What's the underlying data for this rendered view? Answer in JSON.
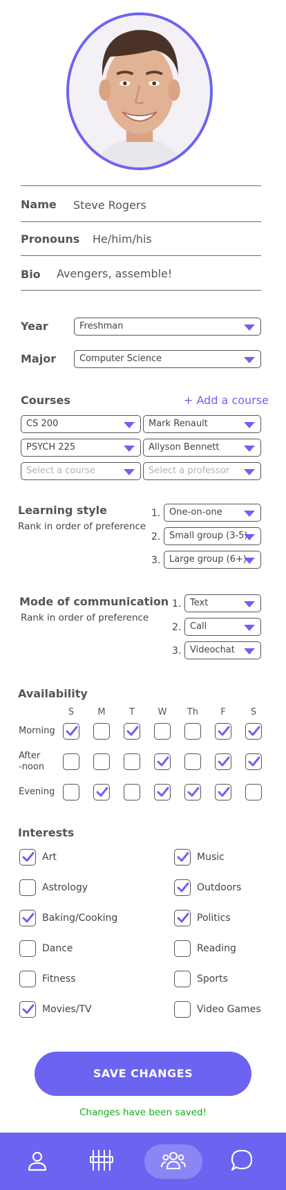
{
  "profile": {
    "name_label": "Name",
    "name_value": "Steve Rogers",
    "pronouns_label": "Pronouns",
    "pronouns_value": "He/him/his",
    "bio_label": "Bio",
    "bio_value": "Avengers, assemble!"
  },
  "academics": {
    "year_label": "Year",
    "year_value": "Freshman",
    "major_label": "Major",
    "major_value": "Computer Science"
  },
  "courses": {
    "title": "Courses",
    "add_label": "+ Add a course",
    "rows": [
      {
        "course": "CS 200",
        "professor": "Mark Renault"
      },
      {
        "course": "PSYCH 225",
        "professor": "Allyson Bennett"
      }
    ],
    "course_placeholder": "Select a course",
    "professor_placeholder": "Select a professor"
  },
  "learning_style": {
    "title": "Learning style",
    "subtitle": "Rank in order of preference",
    "ranks": [
      "1.",
      "2.",
      "3."
    ],
    "options": [
      "One-on-one",
      "Small group (3-5)",
      "Large group (6+)"
    ]
  },
  "communication": {
    "title": "Mode of communication",
    "subtitle": "Rank in order of preference",
    "ranks": [
      "1.",
      "2.",
      "3."
    ],
    "options": [
      "Text",
      "Call",
      "Videochat"
    ]
  },
  "availability": {
    "title": "Availability",
    "days": [
      "S",
      "M",
      "T",
      "W",
      "Th",
      "F",
      "S"
    ],
    "rows": [
      {
        "label": "Morning",
        "checked": [
          true,
          false,
          true,
          false,
          false,
          true,
          true
        ]
      },
      {
        "label_line1": "After",
        "label_line2": "-noon",
        "checked": [
          false,
          false,
          false,
          true,
          false,
          true,
          true
        ]
      },
      {
        "label": "Evening",
        "checked": [
          false,
          true,
          false,
          true,
          true,
          true,
          false
        ]
      }
    ]
  },
  "interests": {
    "title": "Interests",
    "items": [
      {
        "label": "Art",
        "checked": true
      },
      {
        "label": "Music",
        "checked": true
      },
      {
        "label": "Astrology",
        "checked": false
      },
      {
        "label": "Outdoors",
        "checked": true
      },
      {
        "label": "Baking/Cooking",
        "checked": true
      },
      {
        "label": "Politics",
        "checked": true
      },
      {
        "label": "Dance",
        "checked": false
      },
      {
        "label": "Reading",
        "checked": false
      },
      {
        "label": "Fitness",
        "checked": false
      },
      {
        "label": "Sports",
        "checked": false
      },
      {
        "label": "Movies/TV",
        "checked": true
      },
      {
        "label": "Video Games",
        "checked": false
      }
    ]
  },
  "actions": {
    "save_label": "SAVE CHANGES",
    "status_text": "Changes have been saved!"
  },
  "nav": {
    "items": [
      {
        "icon": "profile-icon",
        "active": false
      },
      {
        "icon": "settings-sliders-icon",
        "active": false
      },
      {
        "icon": "group-icon",
        "active": true
      },
      {
        "icon": "chat-icon",
        "active": false
      }
    ]
  },
  "colors": {
    "accent": "#6c63f0",
    "success": "#1aa81a",
    "nav_active": "#8c86f4"
  }
}
